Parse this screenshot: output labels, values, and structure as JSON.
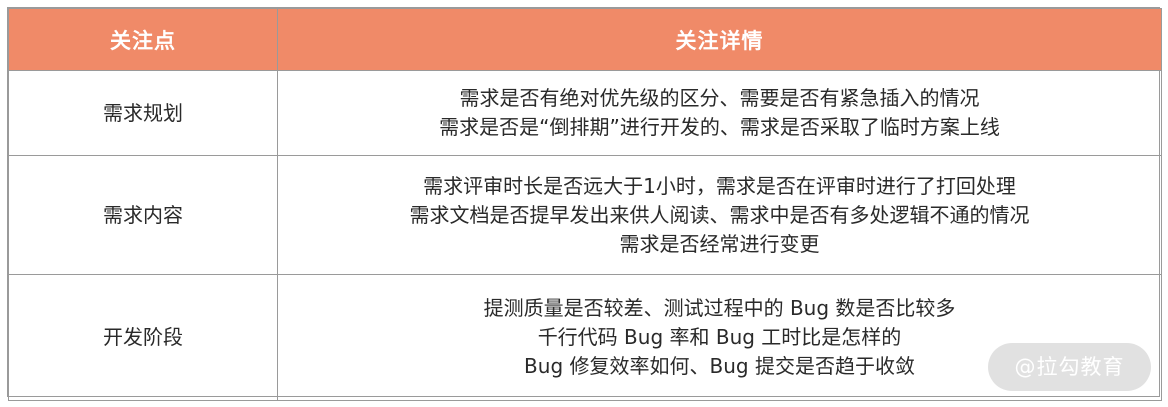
{
  "header": {
    "col1": "关注点",
    "col2": "关注详情"
  },
  "rows": [
    {
      "point": "需求规划",
      "details": [
        "需求是否有绝对优先级的区分、需要是否有紧急插入的情况",
        "需求是否是“倒排期”进行开发的、需求是否采取了临时方案上线"
      ]
    },
    {
      "point": "需求内容",
      "details": [
        "需求评审时长是否远大于1小时，需求是否在评审时进行了打回处理",
        "需求文档是否提早发出来供人阅读、需求中是否有多处逻辑不通的情况",
        "需求是否经常进行变更"
      ]
    },
    {
      "point": "开发阶段",
      "details": [
        "提测质量是否较差、测试过程中的 Bug 数是否比较多",
        "千行代码 Bug 率和 Bug 工时比是怎样的",
        "Bug 修复效率如何、Bug 提交是否趋于收敛"
      ]
    }
  ],
  "watermark": "@拉勾教育",
  "colors": {
    "header_bg": "#f08a68",
    "header_text": "#ffffff",
    "border": "#9a9a9a"
  }
}
